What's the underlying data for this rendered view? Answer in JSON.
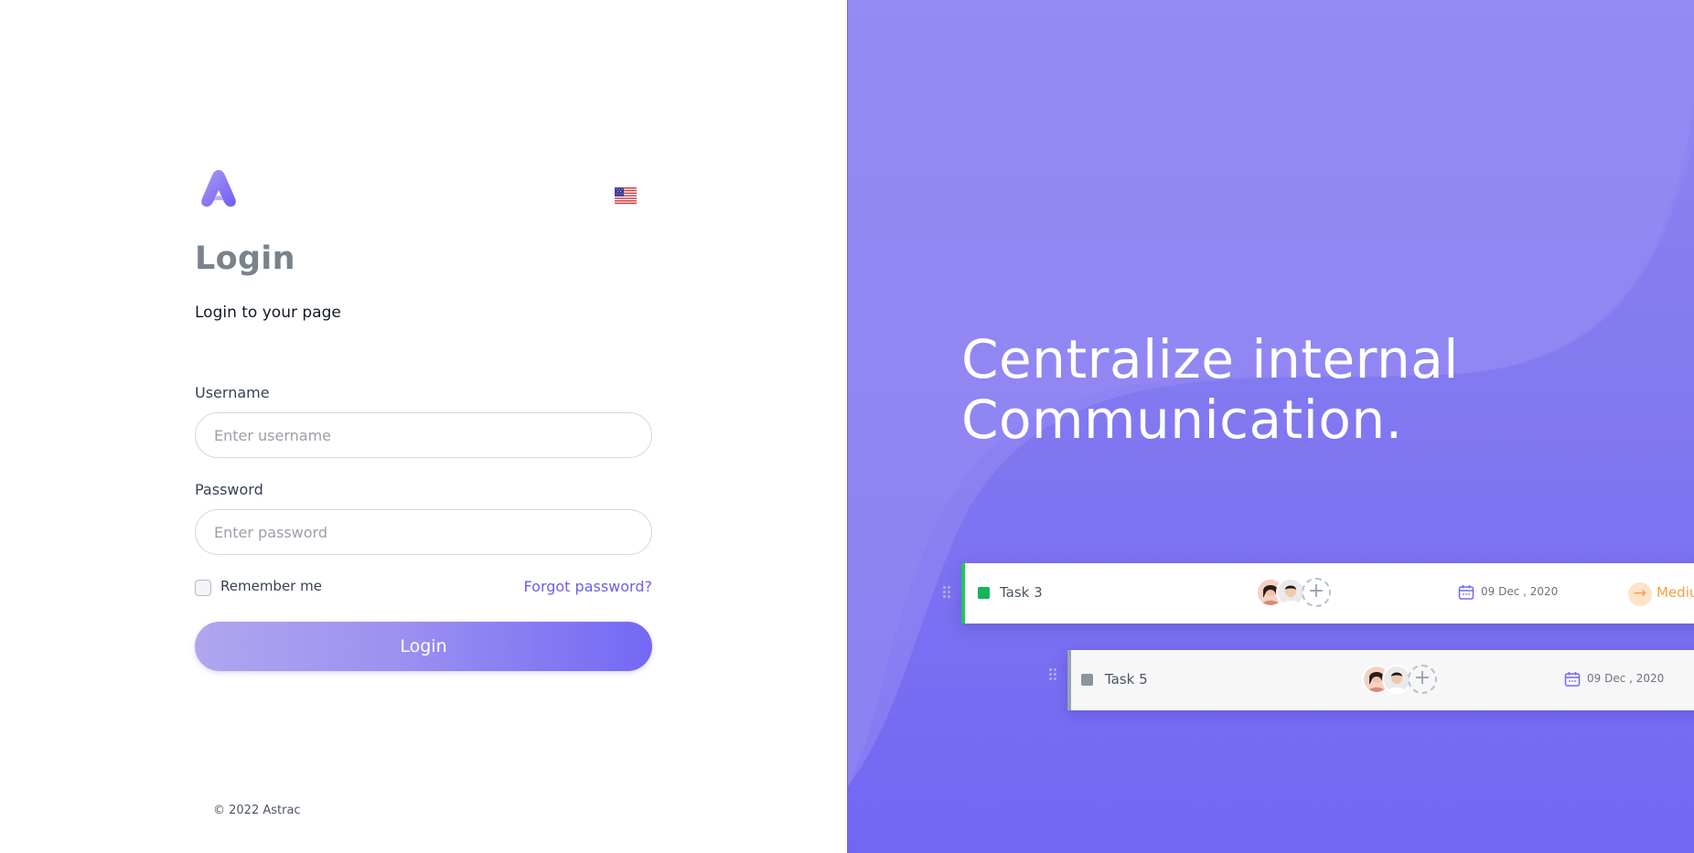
{
  "login_form": {
    "title": "Login",
    "subtitle": "Login to your page",
    "username_label": "Username",
    "username_placeholder": "Enter username",
    "username_value": "",
    "password_label": "Password",
    "password_placeholder": "Enter password",
    "password_value": "",
    "remember_label": "Remember me",
    "remember_checked": false,
    "forgot_label": "Forgot password?",
    "login_button": "Login",
    "language_icon": "us-flag-icon",
    "logo_icon": "astrac-logo-icon"
  },
  "footer": {
    "copyright": "© 2022 Astrac"
  },
  "hero": {
    "headline_line1": "Centralize internal",
    "headline_line2": "Communication."
  },
  "tasks": [
    {
      "name": "Task 3",
      "date": "09 Dec , 2020",
      "status_color": "#16b35a",
      "priority": "Medium"
    },
    {
      "name": "Task 5",
      "date": "09 Dec , 2020",
      "status_color": "#8b95a1"
    }
  ],
  "colors": {
    "accent": "#7468f4",
    "title_gray": "#7a828c",
    "link": "#6b5ef2",
    "panel_bg": "#8379f0",
    "task3_stripe": "#22c55e",
    "priority_orange": "#f59e42"
  }
}
